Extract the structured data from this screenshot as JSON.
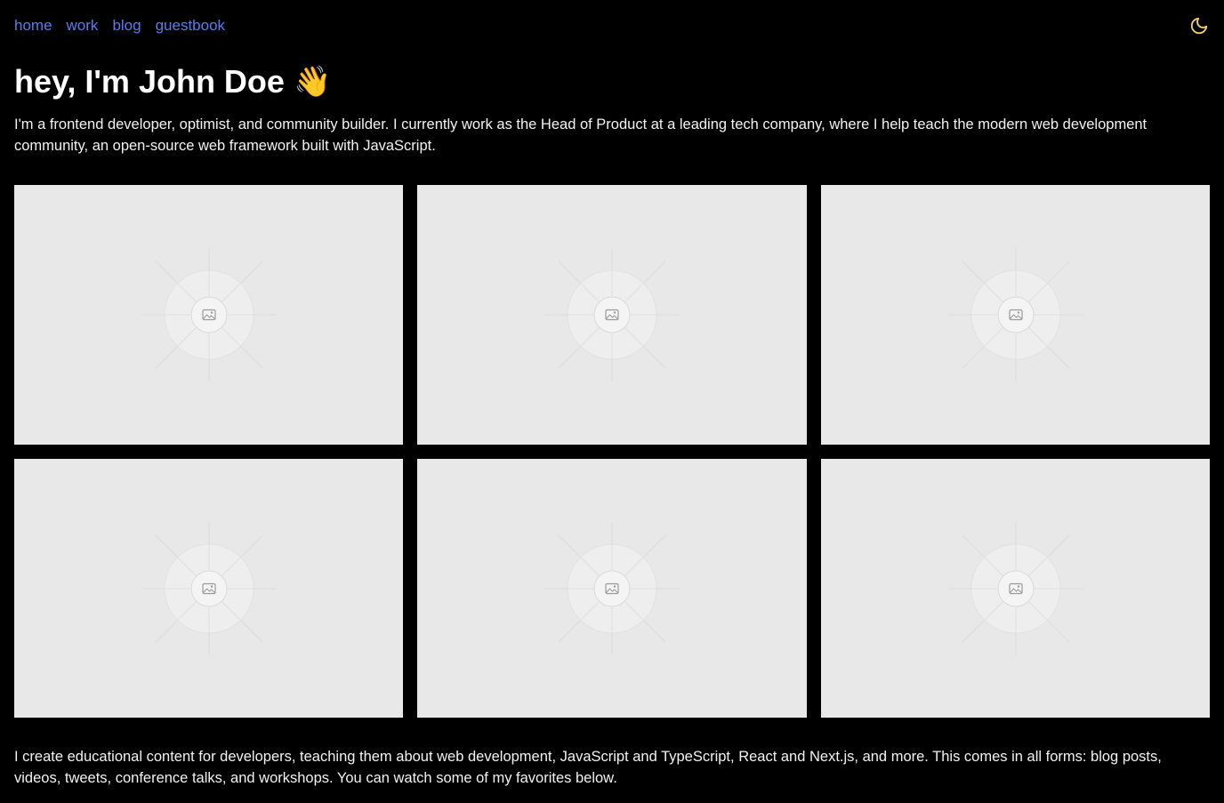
{
  "nav": {
    "links": [
      {
        "label": "home"
      },
      {
        "label": "work"
      },
      {
        "label": "blog"
      },
      {
        "label": "guestbook"
      }
    ],
    "theme_icon": "moon-icon",
    "link_color": "#5b7cf0",
    "icon_color": "#f5d26b"
  },
  "hero": {
    "title": "hey, I'm John Doe",
    "emoji": "👋",
    "intro": "I'm a frontend developer, optimist, and community builder. I currently work as the Head of Product at a leading tech company, where I help teach the modern web development community, an open-source web framework built with JavaScript."
  },
  "gallery": {
    "tiles": [
      {
        "icon": "image-placeholder-icon"
      },
      {
        "icon": "image-placeholder-icon"
      },
      {
        "icon": "image-placeholder-icon"
      },
      {
        "icon": "image-placeholder-icon"
      },
      {
        "icon": "image-placeholder-icon"
      },
      {
        "icon": "image-placeholder-icon"
      }
    ],
    "tile_color": "#e8e8e8"
  },
  "content": {
    "outro": "I create educational content for developers, teaching them about web development, JavaScript and TypeScript, React and Next.js, and more. This comes in all forms: blog posts, videos, tweets, conference talks, and workshops. You can watch some of my favorites below."
  }
}
